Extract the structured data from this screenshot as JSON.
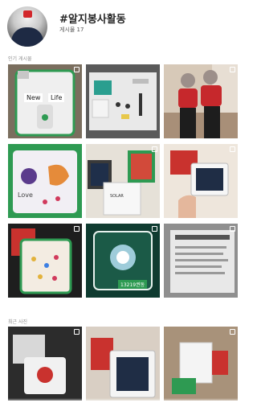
{
  "header": {
    "hashtag": "#알지봉사활동",
    "post_count": "게시물 17"
  },
  "sections": {
    "popular": "인기 게시물",
    "recent": "최근 사진"
  },
  "tiles": {
    "popular_1": {
      "caption_left": "New",
      "caption_right": "Life"
    },
    "popular_8": {
      "caption": "13219권동"
    }
  },
  "icons": {
    "multi_post": "multiple-images-icon"
  },
  "colors": {
    "text": "#262626",
    "muted": "#8e8e8e",
    "frame_green": "#2e9a52"
  }
}
